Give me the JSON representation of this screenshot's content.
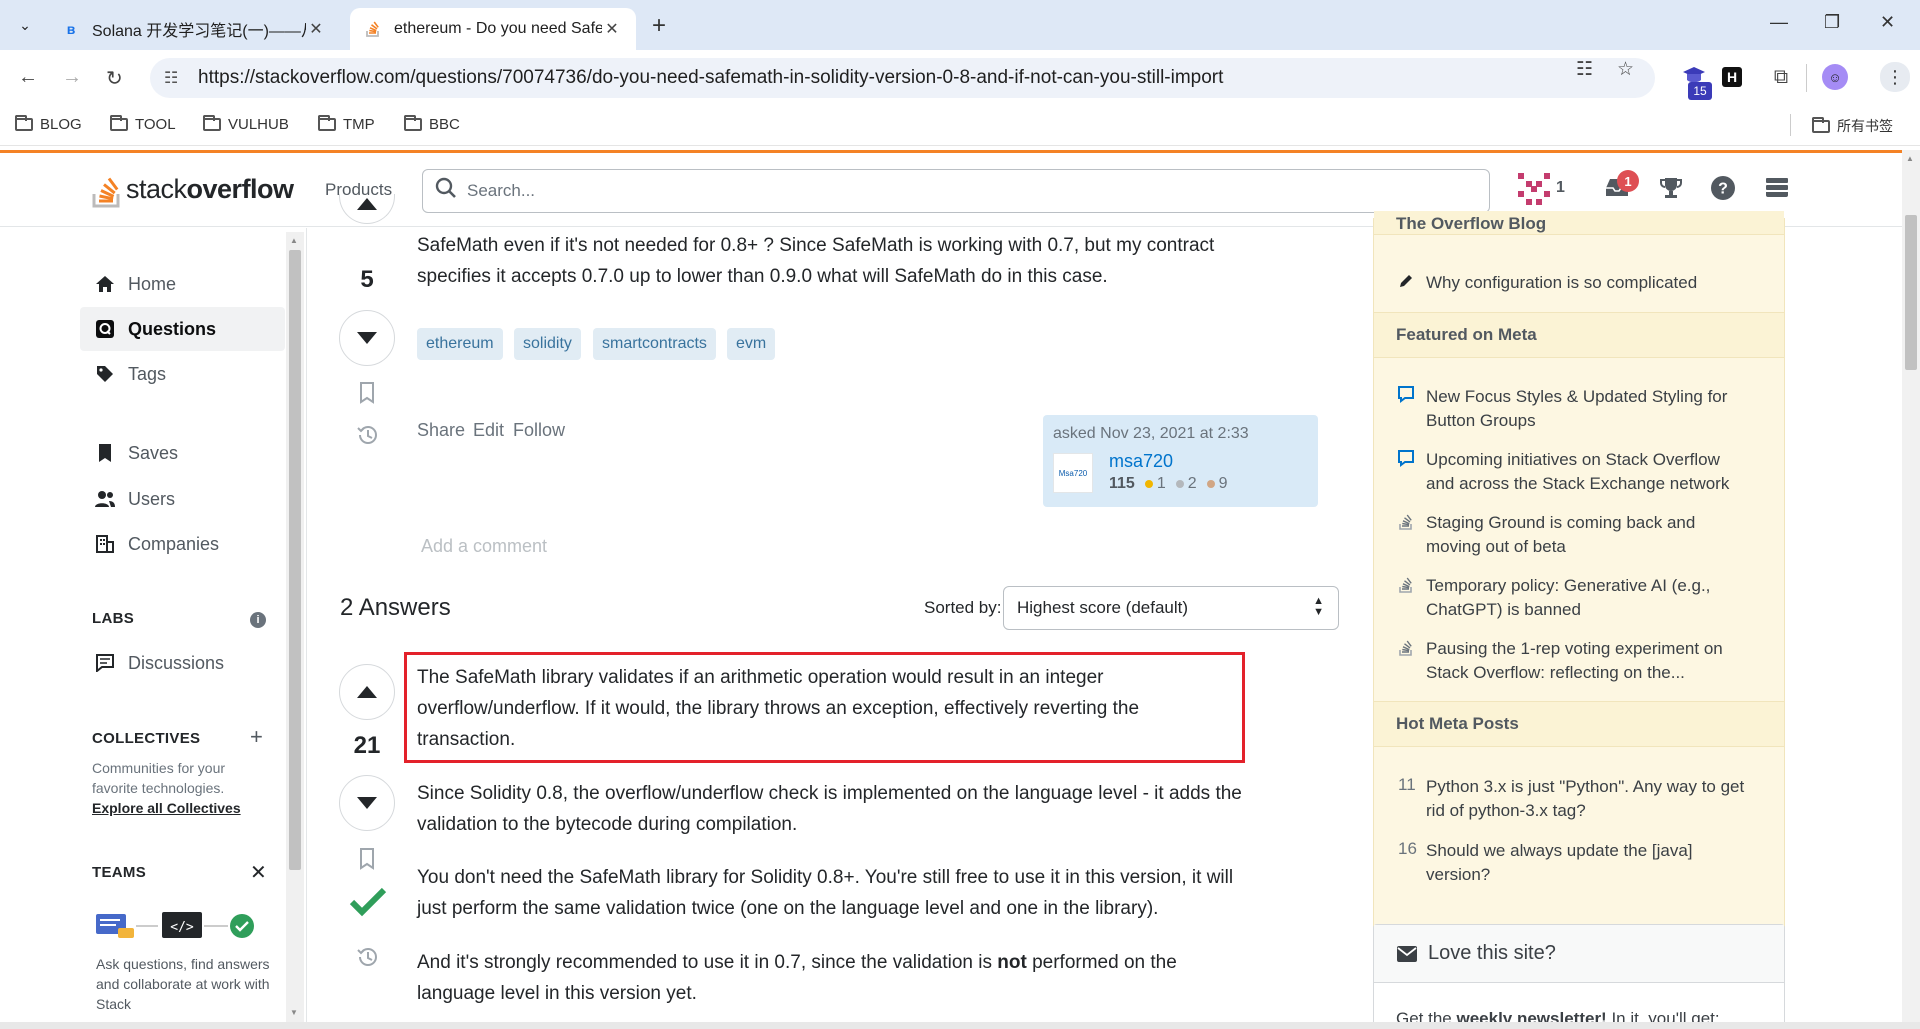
{
  "browser": {
    "tabs": [
      {
        "title": "Solana 开发学习笔记(一)——从",
        "active": false
      },
      {
        "title": "ethereum - Do you need Safe",
        "active": true
      }
    ],
    "url": "https://stackoverflow.com/questions/70074736/do-you-need-safemath-in-solidity-version-0-8-and-if-not-can-you-still-import",
    "extension_badge": "15",
    "bookmarks": [
      "BLOG",
      "TOOL",
      "VULHUB",
      "TMP",
      "BBC"
    ],
    "bookmarks_right": "所有书签"
  },
  "so_header": {
    "logo_light": "stack",
    "logo_bold": "overflow",
    "products": "Products",
    "search_placeholder": "Search...",
    "rep": "1",
    "inbox_count": "1",
    "accent": "#f48225"
  },
  "leftnav": {
    "items": [
      {
        "label": "Home",
        "icon": "home-icon"
      },
      {
        "label": "Questions",
        "icon": "questions-icon",
        "active": true
      },
      {
        "label": "Tags",
        "icon": "tag-icon"
      },
      {
        "label": "Saves",
        "icon": "bookmark-icon"
      },
      {
        "label": "Users",
        "icon": "users-icon"
      },
      {
        "label": "Companies",
        "icon": "companies-icon"
      }
    ],
    "labs": "LABS",
    "discussions": "Discussions",
    "collectives": "COLLECTIVES",
    "collectives_desc": "Communities for your favorite technologies.",
    "collectives_link": "Explore all Collectives",
    "teams": "TEAMS",
    "teams_desc": "Ask questions, find answers and collaborate at work with Stack"
  },
  "question": {
    "body_tail_1": "SafeMath even if it's not needed for 0.8+ ? Since SafeMath is working with 0.7, but my contract",
    "body_tail_2": "specifies it accepts 0.7.0 up to lower than 0.9.0 what will SafeMath do in this case.",
    "score": "5",
    "tags": [
      "ethereum",
      "solidity",
      "smartcontracts",
      "evm"
    ],
    "menu": [
      "Share",
      "Edit",
      "Follow"
    ],
    "asked": "asked Nov 23, 2021 at 2:33",
    "owner_avatar": "Msa720",
    "owner": "msa720",
    "owner_rep": "115",
    "badges": {
      "gold": "1",
      "silver": "2",
      "bronze": "9"
    },
    "add_comment": "Add a comment"
  },
  "answers": {
    "heading": "2 Answers",
    "sorted_by": "Sorted by:",
    "sort_value": "Highest score (default)",
    "score": "21",
    "p1_l1": "The SafeMath library validates if an arithmetic operation would result in an integer",
    "p1_l2": "overflow/underflow. If it would, the library throws an exception, effectively reverting the",
    "p1_l3": "transaction.",
    "p2_l1": "Since Solidity 0.8, the overflow/underflow check is implemented on the language level - it adds the",
    "p2_l2": "validation to the bytecode during compilation.",
    "p3_l1": "You don't need the SafeMath library for Solidity 0.8+. You're still free to use it in this version, it will",
    "p3_l2": "just perform the same validation twice (one on the language level and one in the library).",
    "p4_l1_a": "And it's strongly recommended to use it in 0.7, since the validation is ",
    "p4_l1_b": "not",
    "p4_l1_c": " performed on the",
    "p4_l2": "language level in this version yet."
  },
  "rightbar": {
    "blog_heading": "The Overflow Blog",
    "blog_items": [
      "Why configuration is so complicated"
    ],
    "meta_heading": "Featured on Meta",
    "meta_items": [
      {
        "l1": "New Focus Styles & Updated Styling for",
        "l2": "Button Groups",
        "icon": "comment-bubble-icon"
      },
      {
        "l1": "Upcoming initiatives on Stack Overflow",
        "l2": "and across the Stack Exchange network",
        "icon": "comment-bubble-icon"
      },
      {
        "l1": "Staging Ground is coming back and",
        "l2": "moving out of beta",
        "icon": "stack-logo-icon"
      },
      {
        "l1": "Temporary policy: Generative AI (e.g.,",
        "l2": "ChatGPT) is banned",
        "icon": "stack-logo-icon"
      },
      {
        "l1": "Pausing the 1-rep voting experiment on",
        "l2": "Stack Overflow: reflecting on the...",
        "icon": "stack-logo-icon"
      }
    ],
    "hot_heading": "Hot Meta Posts",
    "hot_items": [
      {
        "count": "11",
        "l1": "Python 3.x is just \"Python\". Any way to get",
        "l2": "rid of python-3.x tag?"
      },
      {
        "count": "16",
        "l1": "Should we always update the [java]",
        "l2": "version?"
      }
    ],
    "love_title": "Love this site?",
    "love_body_a": "Get the ",
    "love_body_b": "weekly newsletter!",
    "love_body_c": " In it, you'll get:"
  }
}
